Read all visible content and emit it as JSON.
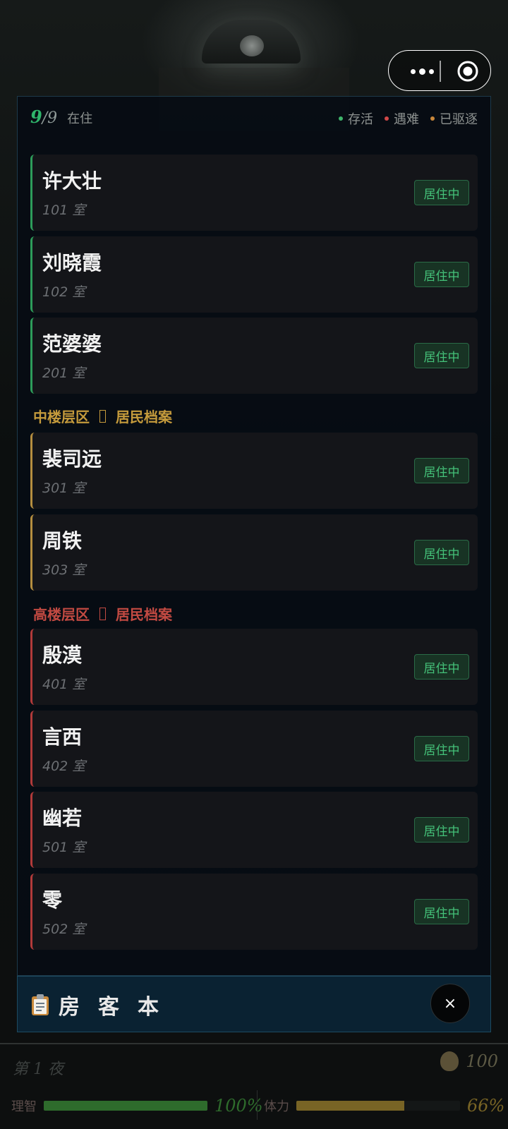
{
  "header": {
    "count_current": "9",
    "count_total": "/9",
    "count_label": "在住",
    "legend": [
      {
        "label": "存活",
        "color": "#3fb56b"
      },
      {
        "label": "遇难",
        "color": "#d04848"
      },
      {
        "label": "已驱逐",
        "color": "#c8873a"
      }
    ]
  },
  "low_floor": [
    {
      "name": "许大壮",
      "room": "101 室",
      "status": "居住中"
    },
    {
      "name": "刘晓霞",
      "room": "102 室",
      "status": "居住中"
    },
    {
      "name": "范婆婆",
      "room": "201 室",
      "status": "居住中"
    }
  ],
  "mid_section": {
    "zone": "中楼层区",
    "title": "居民档案",
    "color": "#c59b3c"
  },
  "mid_floor": [
    {
      "name": "裴司远",
      "room": "301 室",
      "status": "居住中"
    },
    {
      "name": "周铁",
      "room": "303 室",
      "status": "居住中"
    }
  ],
  "high_section": {
    "zone": "高楼层区",
    "title": "居民档案",
    "color": "#c24a42"
  },
  "high_floor": [
    {
      "name": "殷漠",
      "room": "401 室",
      "status": "居住中"
    },
    {
      "name": "言西",
      "room": "402 室",
      "status": "居住中"
    },
    {
      "name": "幽若",
      "room": "501 室",
      "status": "居住中"
    },
    {
      "name": "零",
      "room": "502 室",
      "status": "居住中"
    }
  ],
  "footer": {
    "title": "房客本",
    "close_symbol": "×"
  },
  "hud": {
    "night": "第 1 夜",
    "money": "100",
    "sanity_label": "理智",
    "sanity_value": "100%",
    "sanity_fraction": 1.0,
    "stamina_label": "体力",
    "stamina_value": "66%",
    "stamina_fraction": 0.66
  },
  "colors": {
    "alive": "#3fb56b",
    "sanity_bar": "#2e6b2c",
    "stamina_bar": "#786425"
  }
}
